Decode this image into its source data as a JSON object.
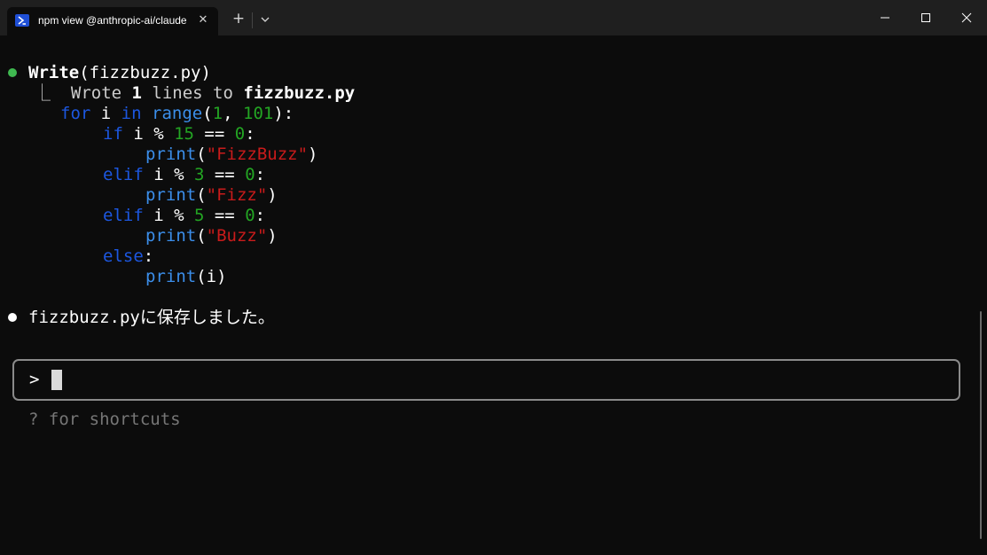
{
  "window": {
    "tab_title": "npm view @anthropic-ai/claude",
    "tab_close": "✕",
    "new_tab": "+",
    "icons": {
      "tab": "powershell-icon",
      "dropdown": "chevron-down-icon",
      "minimize": "minimize-icon",
      "maximize": "maximize-icon",
      "close": "close-icon"
    }
  },
  "terminal": {
    "tool_call": {
      "name": "Write",
      "args": "(fizzbuzz.py)"
    },
    "tool_result": {
      "prefix": "⎿  ",
      "text_a": "Wrote ",
      "count": "1",
      "text_b": " lines to ",
      "file": "fizzbuzz.py"
    },
    "code": {
      "l1": [
        "for",
        " i ",
        "in",
        " ",
        "range",
        "(",
        "1",
        ", ",
        "101",
        "):"
      ],
      "l2": [
        "if",
        " i % ",
        "15",
        " == ",
        "0",
        ":"
      ],
      "l3": [
        "print",
        "(",
        "\"FizzBuzz\"",
        ")"
      ],
      "l4": [
        "elif",
        " i % ",
        "3",
        " == ",
        "0",
        ":"
      ],
      "l5": [
        "print",
        "(",
        "\"Fizz\"",
        ")"
      ],
      "l6": [
        "elif",
        " i % ",
        "5",
        " == ",
        "0",
        ":"
      ],
      "l7": [
        "print",
        "(",
        "\"Buzz\"",
        ")"
      ],
      "l8": [
        "else",
        ":"
      ],
      "l9": [
        "print",
        "(i)"
      ]
    },
    "message": "fizzbuzz.pyに保存しました。",
    "prompt_symbol": ">",
    "hint": "? for shortcuts"
  },
  "colors": {
    "background": "#0c0c0c",
    "titlebar": "#1f1f1f",
    "keyword": "#1c57e0",
    "function": "#3b8eea",
    "number": "#23a523",
    "string": "#c91b1b",
    "success_dot": "#3fb950"
  }
}
